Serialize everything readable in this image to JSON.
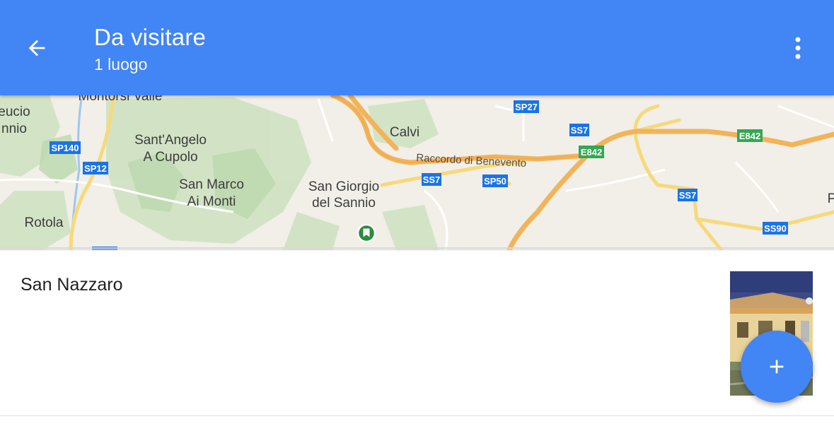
{
  "header": {
    "title": "Da visitare",
    "subtitle": "1 luogo",
    "back_icon": "arrow-back-icon",
    "menu_icon": "more-vert-icon"
  },
  "map": {
    "places": [
      "Montorsi Valle",
      "eucio",
      "nnio",
      "Sant'Angelo",
      "A Cupolo",
      "San Marco",
      "Ai Monti",
      "Rotola",
      "Calvi",
      "San Giorgio",
      "del Sannio",
      "P"
    ],
    "road_label": "Raccordo di Benevento",
    "shields": [
      "SP140",
      "SP12",
      "SP27",
      "SS7",
      "E842",
      "SS7",
      "SP50",
      "E842",
      "SS7",
      "SS90"
    ],
    "marker_icon": "saved-place-marker-icon"
  },
  "list": {
    "items": [
      {
        "name": "San Nazzaro",
        "thumbnail": "street-view-photo"
      }
    ]
  },
  "fab": {
    "icon": "add-icon"
  },
  "colors": {
    "primary": "#4285f4",
    "highway": "#f5b85a",
    "shield_blue": "#1a73e8",
    "shield_green": "#34a853",
    "marker_green": "#2e8b3d"
  }
}
